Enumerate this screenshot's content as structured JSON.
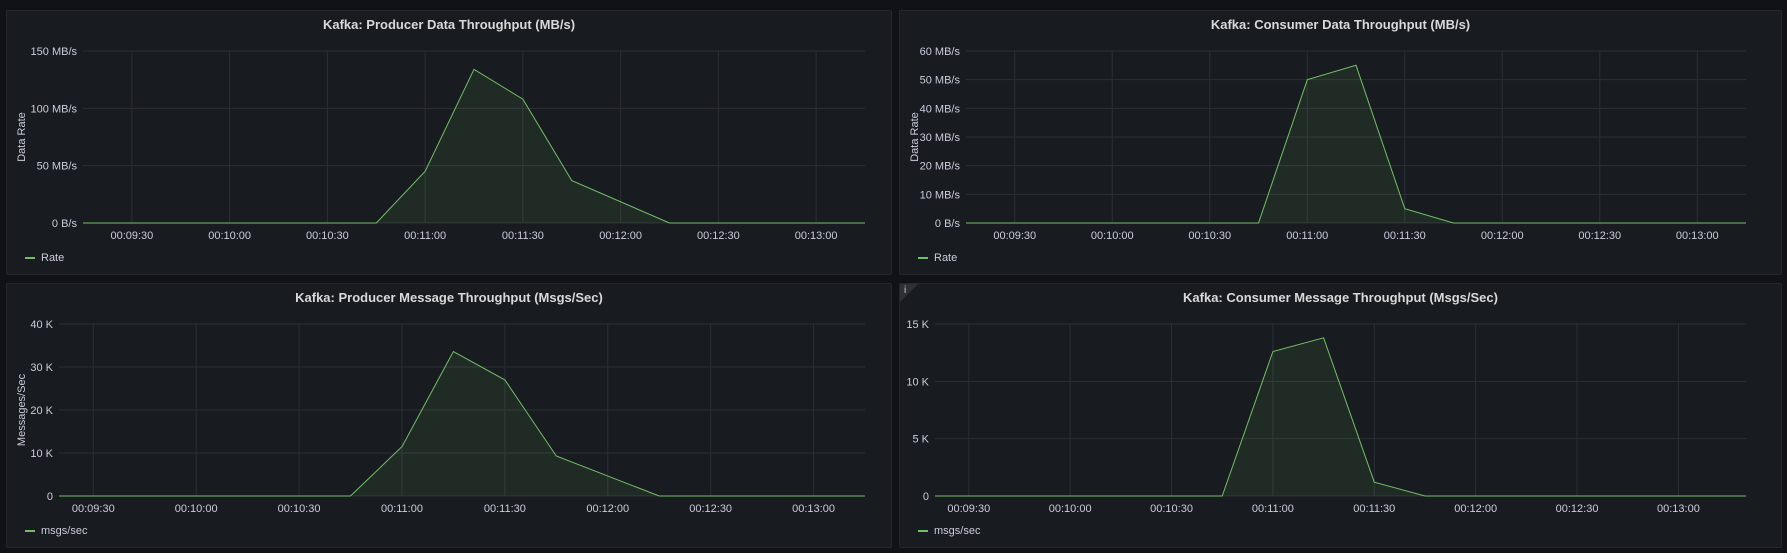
{
  "dashboard": {
    "series_color": "#73bf69",
    "panels": [
      {
        "title": "Kafka: Producer Data Throughput (MB/s)",
        "legend": "Rate",
        "info": null,
        "chart_data": {
          "type": "area",
          "ylabel": "Data Rate",
          "ylim": [
            0,
            150
          ],
          "yticks": [
            0,
            50,
            100,
            150
          ],
          "ytick_labels": [
            "0 B/s",
            "50 MB/s",
            "100 MB/s",
            "150 MB/s"
          ],
          "xlim": [
            "00:09:15",
            "00:13:15"
          ],
          "xtick_labels": [
            "00:09:30",
            "00:10:00",
            "00:10:30",
            "00:11:00",
            "00:11:30",
            "00:12:00",
            "00:12:30",
            "00:13:00"
          ],
          "x": [
            "00:09:15",
            "00:10:45",
            "00:11:00",
            "00:11:15",
            "00:11:30",
            "00:11:45",
            "00:12:15",
            "00:13:15"
          ],
          "series": [
            {
              "name": "Rate",
              "values": [
                0,
                0,
                45,
                134,
                108,
                37,
                0,
                0
              ]
            }
          ],
          "grid": true,
          "legend_position": "bottom-left"
        }
      },
      {
        "title": "Kafka: Consumer Data Throughput (MB/s)",
        "legend": "Rate",
        "info": null,
        "chart_data": {
          "type": "area",
          "ylabel": "Data Rate",
          "ylim": [
            0,
            60
          ],
          "yticks": [
            0,
            10,
            20,
            30,
            40,
            50,
            60
          ],
          "ytick_labels": [
            "0 B/s",
            "10 MB/s",
            "20 MB/s",
            "30 MB/s",
            "40 MB/s",
            "50 MB/s",
            "60 MB/s"
          ],
          "xlim": [
            "00:09:15",
            "00:13:15"
          ],
          "xtick_labels": [
            "00:09:30",
            "00:10:00",
            "00:10:30",
            "00:11:00",
            "00:11:30",
            "00:12:00",
            "00:12:30",
            "00:13:00"
          ],
          "x": [
            "00:09:15",
            "00:10:45",
            "00:11:00",
            "00:11:15",
            "00:11:30",
            "00:11:45",
            "00:13:15"
          ],
          "series": [
            {
              "name": "Rate",
              "values": [
                0,
                0,
                50,
                55,
                5,
                0,
                0
              ]
            }
          ],
          "grid": true,
          "legend_position": "bottom-left"
        }
      },
      {
        "title": "Kafka: Producer Message Throughput (Msgs/Sec)",
        "legend": "msgs/sec",
        "info": null,
        "chart_data": {
          "type": "area",
          "ylabel": "Messages/Sec",
          "ylim": [
            0,
            40000
          ],
          "yticks": [
            0,
            10000,
            20000,
            30000,
            40000
          ],
          "ytick_labels": [
            "0",
            "10 K",
            "20 K",
            "30 K",
            "40 K"
          ],
          "xlim": [
            "00:09:20",
            "00:13:15"
          ],
          "xtick_labels": [
            "00:09:30",
            "00:10:00",
            "00:10:30",
            "00:11:00",
            "00:11:30",
            "00:12:00",
            "00:12:30",
            "00:13:00"
          ],
          "x": [
            "00:09:20",
            "00:10:45",
            "00:11:00",
            "00:11:15",
            "00:11:30",
            "00:11:45",
            "00:12:15",
            "00:13:15"
          ],
          "series": [
            {
              "name": "msgs/sec",
              "values": [
                0,
                0,
                11500,
                33600,
                27000,
                9300,
                0,
                0
              ]
            }
          ],
          "grid": true,
          "legend_position": "bottom-left"
        }
      },
      {
        "title": "Kafka: Consumer Message Throughput (Msgs/Sec)",
        "legend": "msgs/sec",
        "info": "i",
        "chart_data": {
          "type": "area",
          "ylabel": "",
          "ylim": [
            0,
            15000
          ],
          "yticks": [
            0,
            5000,
            10000,
            15000
          ],
          "ytick_labels": [
            "0",
            "5 K",
            "10 K",
            "15 K"
          ],
          "xlim": [
            "00:09:20",
            "00:13:20"
          ],
          "xtick_labels": [
            "00:09:30",
            "00:10:00",
            "00:10:30",
            "00:11:00",
            "00:11:30",
            "00:12:00",
            "00:12:30",
            "00:13:00"
          ],
          "x": [
            "00:09:20",
            "00:10:45",
            "00:11:00",
            "00:11:15",
            "00:11:30",
            "00:11:45",
            "00:13:20"
          ],
          "series": [
            {
              "name": "msgs/sec",
              "values": [
                0,
                0,
                12600,
                13800,
                1200,
                0,
                0
              ]
            }
          ],
          "grid": true,
          "legend_position": "bottom-left"
        }
      }
    ]
  }
}
